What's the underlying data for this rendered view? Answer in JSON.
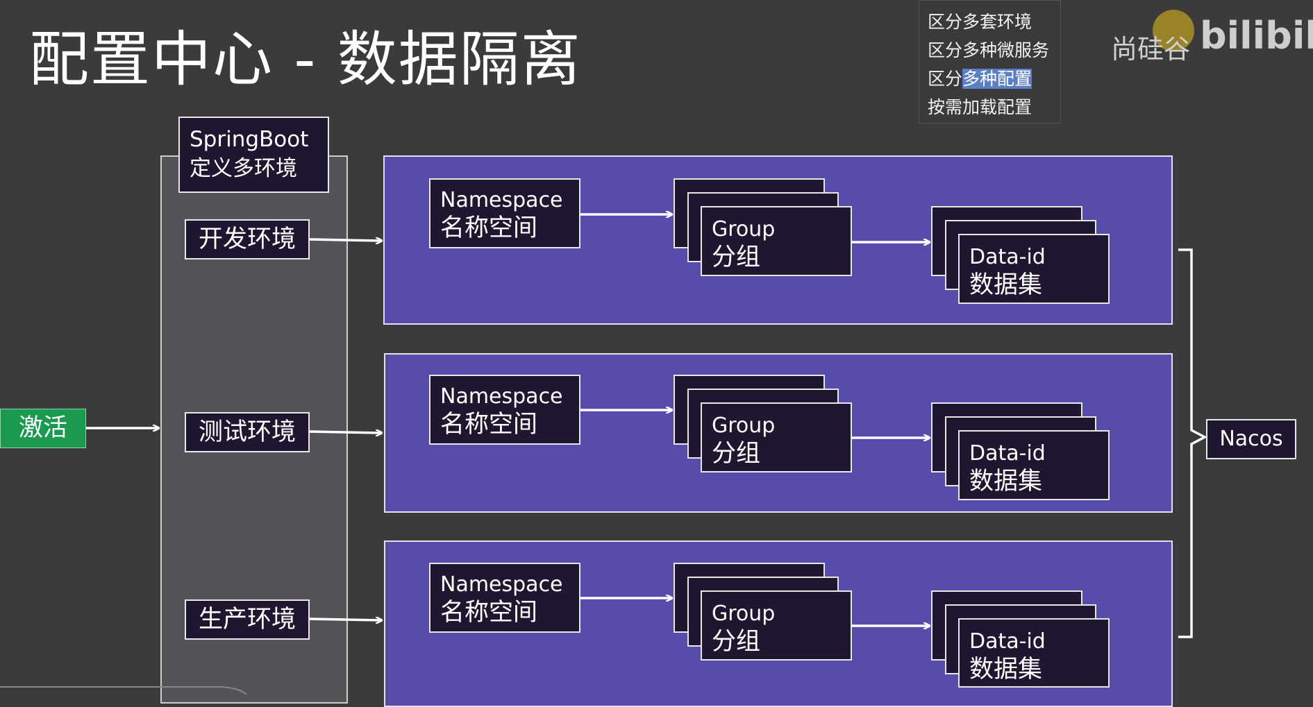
{
  "title": "配置中心 - 数据隔离",
  "popup": {
    "items": [
      "区分多套环境",
      "区分多种微服务",
      "区分",
      "按需加载配置"
    ],
    "highlight": "多种配置"
  },
  "logo": {
    "text": "尚硅谷",
    "bili": "bilibili"
  },
  "springboot": {
    "line1": "SpringBoot",
    "line2": "定义多环境"
  },
  "environments": [
    "开发环境",
    "测试环境",
    "生产环境"
  ],
  "activate_label": "激活",
  "rows": [
    {
      "namespace": {
        "en": "Namespace",
        "zh": "名称空间"
      },
      "group": {
        "en": "Group",
        "zh": "分组"
      },
      "dataid": {
        "en": "Data-id",
        "zh": "数据集"
      }
    },
    {
      "namespace": {
        "en": "Namespace",
        "zh": "名称空间"
      },
      "group": {
        "en": "Group",
        "zh": "分组"
      },
      "dataid": {
        "en": "Data-id",
        "zh": "数据集"
      }
    },
    {
      "namespace": {
        "en": "Namespace",
        "zh": "名称空间"
      },
      "group": {
        "en": "Group",
        "zh": "分组"
      },
      "dataid": {
        "en": "Data-id",
        "zh": "数据集"
      }
    }
  ],
  "nacos_label": "Nacos"
}
